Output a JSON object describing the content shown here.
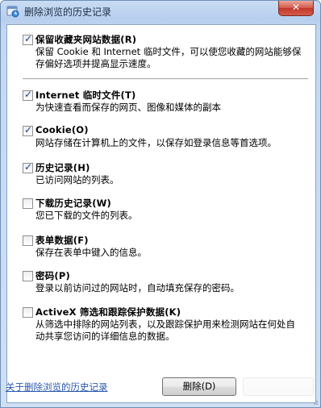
{
  "window": {
    "title": "删除浏览的历史记录",
    "close_label": "✕"
  },
  "options": [
    {
      "checked": true,
      "check_mark": "✓",
      "label": "保留收藏夹网站数据(R)",
      "description": "保留 Cookie 和 Internet 临时文件，可以使您收藏的网站能够保存偏好选项并提高显示速度。"
    },
    {
      "checked": true,
      "check_mark": "✓",
      "label": "Internet 临时文件(T)",
      "description": "为快速查看而保存的网页、图像和媒体的副本"
    },
    {
      "checked": true,
      "check_mark": "✓",
      "label": "Cookie(O)",
      "description": "网站存储在计算机上的文件，以保存如登录信息等首选项。"
    },
    {
      "checked": true,
      "check_mark": "✓",
      "label": "历史记录(H)",
      "description": "已访问网站的列表。"
    },
    {
      "checked": false,
      "check_mark": "",
      "label": "下载历史记录(W)",
      "description": "您已下载的文件的列表。"
    },
    {
      "checked": false,
      "check_mark": "",
      "label": "表单数据(F)",
      "description": "保存在表单中键入的信息。"
    },
    {
      "checked": false,
      "check_mark": "",
      "label": "密码(P)",
      "description": "登录以前访问过的网站时，自动填充保存的密码。"
    },
    {
      "checked": false,
      "check_mark": "",
      "label": "ActiveX 筛选和跟踪保护数据(K)",
      "description": "从筛选中排除的网站列表，以及跟踪保护用来检测网站在何处自动共享您访问的详细信息的数据。"
    }
  ],
  "footer": {
    "help_link": "关于删除浏览的历史记录",
    "delete_button": "删除(D)"
  }
}
